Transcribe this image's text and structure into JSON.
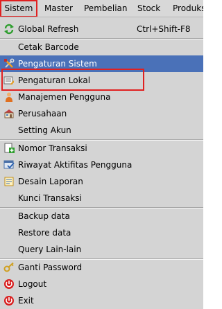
{
  "menubar": {
    "items": [
      {
        "label": "Sistem"
      },
      {
        "label": "Master"
      },
      {
        "label": "Pembelian"
      },
      {
        "label": "Stock"
      },
      {
        "label": "Produksi"
      }
    ]
  },
  "menu": {
    "items": [
      {
        "label": "Global Refresh",
        "shortcut": "Ctrl+Shift-F8",
        "icon": "refresh-icon"
      },
      {
        "label": "Cetak Barcode"
      },
      {
        "label": "Pengaturan Sistem",
        "icon": "tools-icon",
        "highlighted": true
      },
      {
        "label": "Pengaturan Lokal",
        "icon": "settings-local-icon"
      },
      {
        "label": "Manajemen Pengguna",
        "icon": "user-icon"
      },
      {
        "label": "Perusahaan",
        "icon": "company-icon"
      },
      {
        "label": "Setting Akun"
      },
      {
        "label": "Nomor Transaksi",
        "icon": "add-document-icon"
      },
      {
        "label": "Riwayat Aktifitas Pengguna",
        "icon": "history-icon"
      },
      {
        "label": "Desain Laporan",
        "icon": "report-design-icon"
      },
      {
        "label": "Kunci Transaksi"
      },
      {
        "label": "Backup data"
      },
      {
        "label": "Restore data"
      },
      {
        "label": "Query Lain-lain"
      },
      {
        "label": "Ganti Password",
        "icon": "key-icon"
      },
      {
        "label": "Logout",
        "icon": "logout-icon"
      },
      {
        "label": "Exit",
        "icon": "exit-icon"
      }
    ]
  },
  "colors": {
    "highlight": "#4a71b8",
    "annotation": "#e02020"
  }
}
